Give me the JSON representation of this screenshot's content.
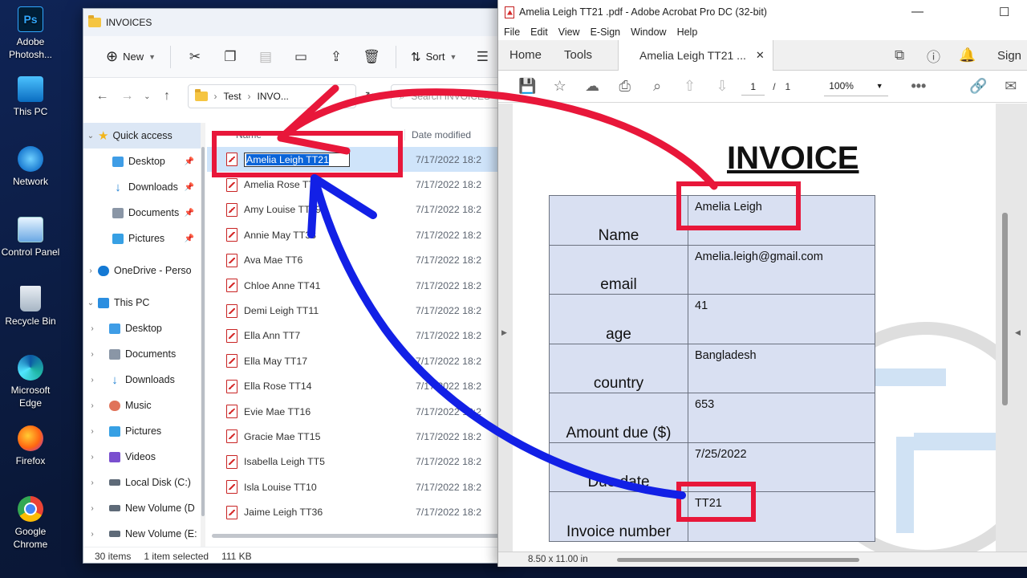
{
  "desktop": {
    "icons": [
      {
        "label": "Adobe Photosh...",
        "icon": "photoshop-icon",
        "glyph": "Ps"
      },
      {
        "label": "This PC",
        "icon": "computer-icon",
        "glyph": ""
      },
      {
        "label": "Network",
        "icon": "network-icon",
        "glyph": ""
      },
      {
        "label": "Control Panel",
        "icon": "control-panel-icon",
        "glyph": ""
      },
      {
        "label": "Recycle Bin",
        "icon": "recycle-bin-icon",
        "glyph": ""
      },
      {
        "label": "Microsoft Edge",
        "icon": "edge-icon",
        "glyph": ""
      },
      {
        "label": "Firefox",
        "icon": "firefox-icon",
        "glyph": ""
      },
      {
        "label": "Google Chrome",
        "icon": "chrome-icon",
        "glyph": ""
      }
    ]
  },
  "explorer": {
    "title": "INVOICES",
    "toolbar": {
      "new_label": "New",
      "sort_label": "Sort"
    },
    "address": {
      "parts": [
        "Test",
        "INVO..."
      ],
      "search_placeholder": "Search INVOICES"
    },
    "nav": {
      "quick_access": "Quick access",
      "quick_items": [
        "Desktop",
        "Downloads",
        "Documents",
        "Pictures"
      ],
      "onedrive": "OneDrive - Perso",
      "this_pc": "This PC",
      "pc_items": [
        "Desktop",
        "Documents",
        "Downloads",
        "Music",
        "Pictures",
        "Videos",
        "Local Disk (C:)",
        "New Volume (D",
        "New Volume (E:"
      ]
    },
    "columns": {
      "name": "Name",
      "date": "Date modified"
    },
    "files": [
      {
        "name": "Amelia Leigh TT21",
        "date": "7/17/2022 18:2",
        "selected": true
      },
      {
        "name": "Amelia Rose TT1",
        "date": "7/17/2022 18:2"
      },
      {
        "name": "Amy Louise TT29",
        "date": "7/17/2022 18:2"
      },
      {
        "name": "Annie May TT38",
        "date": "7/17/2022 18:2"
      },
      {
        "name": "Ava Mae TT6",
        "date": "7/17/2022 18:2"
      },
      {
        "name": "Chloe Anne TT41",
        "date": "7/17/2022 18:2"
      },
      {
        "name": "Demi Leigh TT11",
        "date": "7/17/2022 18:2"
      },
      {
        "name": "Ella Ann TT7",
        "date": "7/17/2022 18:2"
      },
      {
        "name": "Ella May TT17",
        "date": "7/17/2022 18:2"
      },
      {
        "name": "Ella Rose TT14",
        "date": "7/17/2022 18:2"
      },
      {
        "name": "Evie Mae TT16",
        "date": "7/17/2022 18:2"
      },
      {
        "name": "Gracie Mae TT15",
        "date": "7/17/2022 18:2"
      },
      {
        "name": "Isabella Leigh TT5",
        "date": "7/17/2022 18:2"
      },
      {
        "name": "Isla Louise TT10",
        "date": "7/17/2022 18:2"
      },
      {
        "name": "Jaime Leigh TT36",
        "date": "7/17/2022 18:2"
      }
    ],
    "status": {
      "count": "30 items",
      "selected": "1 item selected",
      "size": "111 KB"
    }
  },
  "acrobat": {
    "title": "Amelia Leigh TT21 .pdf - Adobe Acrobat Pro DC (32-bit)",
    "menu": [
      "File",
      "Edit",
      "View",
      "E-Sign",
      "Window",
      "Help"
    ],
    "tabs": {
      "home": "Home",
      "tools": "Tools",
      "doc": "Amelia Leigh TT21 ...",
      "sign": "Sign"
    },
    "page": {
      "current": "1",
      "sep": "/",
      "total": "1"
    },
    "zoom": "100%",
    "page_size": "8.50 x 11.00 in",
    "invoice": {
      "heading": "INVOICE",
      "rows": [
        {
          "label": "Name",
          "value": "Amelia Leigh"
        },
        {
          "label": "email",
          "value": "Amelia.leigh@gmail.com"
        },
        {
          "label": "age",
          "value": "41"
        },
        {
          "label": "country",
          "value": "Bangladesh"
        },
        {
          "label": "Amount due ($)",
          "value": "653"
        },
        {
          "label": "Due date",
          "value": "7/25/2022"
        },
        {
          "label": "Invoice number",
          "value": "TT21"
        }
      ]
    }
  },
  "annotations": {
    "red": "#e8173a",
    "blue": "#1220e6"
  }
}
